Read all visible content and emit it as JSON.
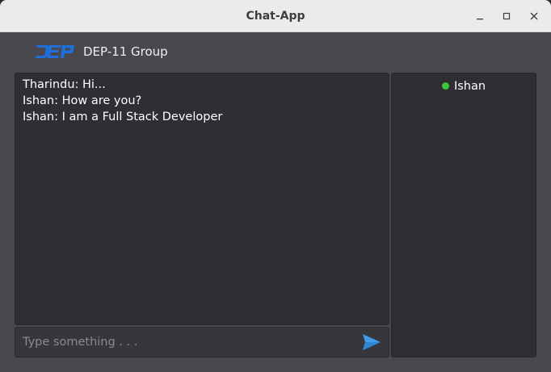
{
  "window": {
    "title": "Chat-App"
  },
  "header": {
    "logo_text": "DEP",
    "group_name": "DEP-11 Group"
  },
  "messages": [
    {
      "sender": "Tharindu",
      "text": "Hi...",
      "display": "Tharindu: Hi..."
    },
    {
      "sender": "Ishan",
      "text": "How are you?",
      "display": "Ishan: How are you?"
    },
    {
      "sender": "Ishan",
      "text": "I am a Full Stack Developer",
      "display": "Ishan: I am a Full Stack Developer"
    }
  ],
  "input": {
    "placeholder": "Type something . . .",
    "value": ""
  },
  "users": [
    {
      "name": "Ishan",
      "status": "online",
      "status_color": "#3cc43c"
    }
  ],
  "icons": {
    "send": "send-icon",
    "minimize": "minimize-icon",
    "maximize": "maximize-icon",
    "close": "close-icon"
  },
  "colors": {
    "accent": "#3d9be9",
    "logo": "#1e6fd9",
    "online": "#3cc43c",
    "window_bg": "#48484e",
    "panel_bg": "#2e2e33"
  }
}
